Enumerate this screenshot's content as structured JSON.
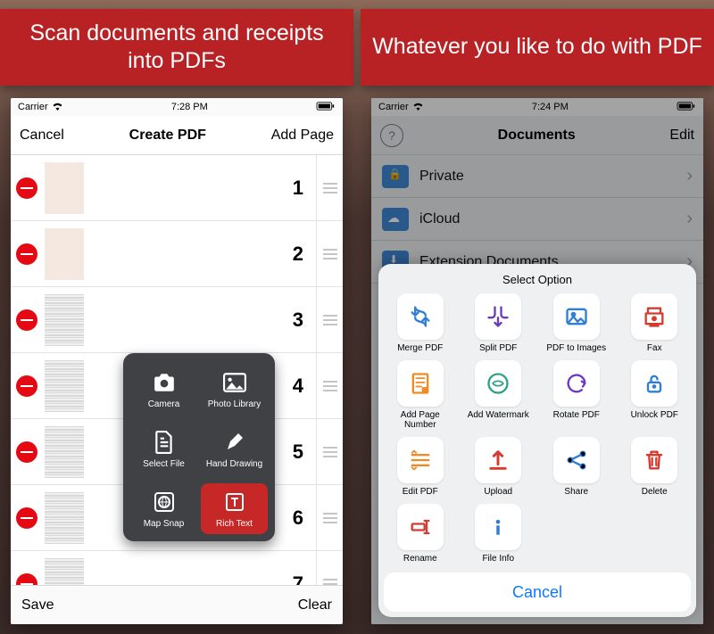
{
  "banners": {
    "left": "Scan documents and receipts into PDFs",
    "right": "Whatever you like to do with PDF"
  },
  "left_screen": {
    "status": {
      "carrier": "Carrier",
      "time": "7:28 PM"
    },
    "nav": {
      "cancel": "Cancel",
      "title": "Create PDF",
      "add_page": "Add Page"
    },
    "pages": [
      {
        "n": "1"
      },
      {
        "n": "2"
      },
      {
        "n": "3"
      },
      {
        "n": "4"
      },
      {
        "n": "5"
      },
      {
        "n": "6"
      },
      {
        "n": "7"
      }
    ],
    "popover": [
      {
        "label": "Camera",
        "icon": "camera-icon"
      },
      {
        "label": "Photo Library",
        "icon": "image-icon"
      },
      {
        "label": "Select File",
        "icon": "file-icon"
      },
      {
        "label": "Hand Drawing",
        "icon": "pen-icon"
      },
      {
        "label": "Map Snap",
        "icon": "globe-icon"
      },
      {
        "label": "Rich Text",
        "icon": "text-icon",
        "active": true
      }
    ],
    "toolbar": {
      "save": "Save",
      "clear": "Clear"
    }
  },
  "right_screen": {
    "status": {
      "carrier": "Carrier",
      "time": "7:24 PM"
    },
    "nav": {
      "help": "?",
      "title": "Documents",
      "edit": "Edit"
    },
    "folders": [
      {
        "label": "Private"
      },
      {
        "label": "iCloud"
      },
      {
        "label": "Extension Documents"
      }
    ],
    "sheet": {
      "title": "Select Option",
      "options": [
        {
          "label": "Merge PDF",
          "color": "#2f7fd6"
        },
        {
          "label": "Split PDF",
          "color": "#6a3bbf"
        },
        {
          "label": "PDF to Images",
          "color": "#2f7fd6"
        },
        {
          "label": "Fax",
          "color": "#d6392e"
        },
        {
          "label": "Add Page Number",
          "color": "#f08a24"
        },
        {
          "label": "Add Watermark",
          "color": "#2fa08a"
        },
        {
          "label": "Rotate PDF",
          "color": "#6a3bbf"
        },
        {
          "label": "Unlock PDF",
          "color": "#2f7fd6"
        },
        {
          "label": "Edit PDF",
          "color": "#f08a24"
        },
        {
          "label": "Upload",
          "color": "#d6392e"
        },
        {
          "label": "Share",
          "color": "#2f7fd6"
        },
        {
          "label": "Delete",
          "color": "#d6392e"
        },
        {
          "label": "Rename",
          "color": "#d6392e"
        },
        {
          "label": "File Info",
          "color": "#2f7fd6"
        }
      ],
      "cancel": "Cancel"
    }
  }
}
